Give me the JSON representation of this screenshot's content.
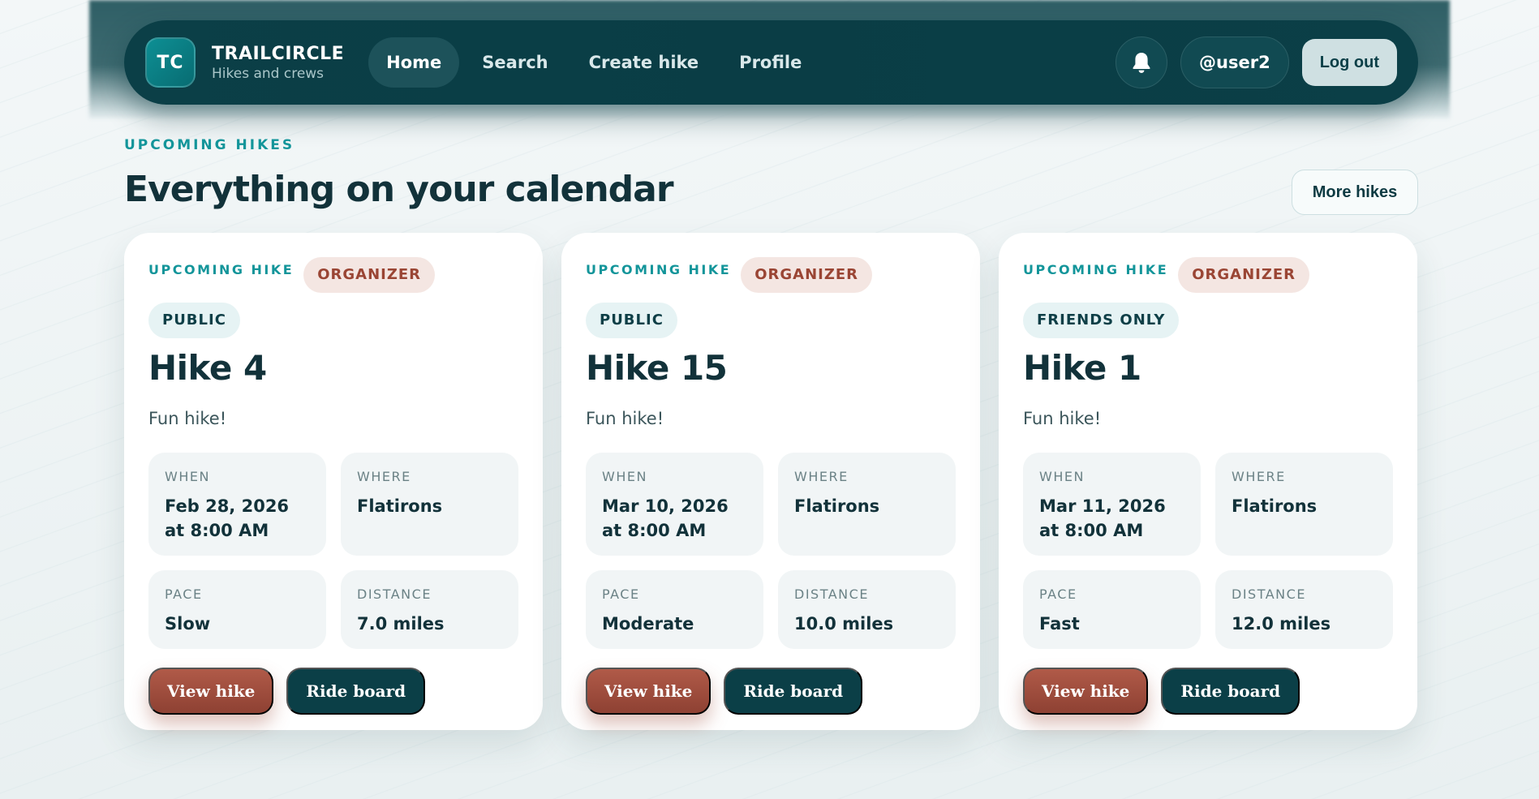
{
  "nav": {
    "logo_initials": "TC",
    "brand_name": "TRAILCIRCLE",
    "brand_subtitle": "Hikes and crews",
    "links": [
      {
        "label": "Home",
        "active": true
      },
      {
        "label": "Search",
        "active": false
      },
      {
        "label": "Create hike",
        "active": false
      },
      {
        "label": "Profile",
        "active": false
      }
    ],
    "bell_icon": "bell-icon",
    "user_handle": "@user2",
    "logout_label": "Log out"
  },
  "section": {
    "eyebrow": "UPCOMING HIKES",
    "title": "Everything on your calendar",
    "more_label": "More hikes"
  },
  "cards": [
    {
      "eyebrow": "UPCOMING HIKE",
      "role_badge": "ORGANIZER",
      "visibility_badge": "PUBLIC",
      "title": "Hike 4",
      "description": "Fun hike!",
      "when_label": "WHEN",
      "when_value": "Feb 28, 2026 at 8:00 AM",
      "where_label": "WHERE",
      "where_value": "Flatirons",
      "pace_label": "PACE",
      "pace_value": "Slow",
      "distance_label": "DISTANCE",
      "distance_value": "7.0 miles",
      "view_label": "View hike",
      "ride_label": "Ride board"
    },
    {
      "eyebrow": "UPCOMING HIKE",
      "role_badge": "ORGANIZER",
      "visibility_badge": "PUBLIC",
      "title": "Hike 15",
      "description": "Fun hike!",
      "when_label": "WHEN",
      "when_value": "Mar 10, 2026 at 8:00 AM",
      "where_label": "WHERE",
      "where_value": "Flatirons",
      "pace_label": "PACE",
      "pace_value": "Moderate",
      "distance_label": "DISTANCE",
      "distance_value": "10.0 miles",
      "view_label": "View hike",
      "ride_label": "Ride board"
    },
    {
      "eyebrow": "UPCOMING HIKE",
      "role_badge": "ORGANIZER",
      "visibility_badge": "FRIENDS ONLY",
      "title": "Hike 1",
      "description": "Fun hike!",
      "when_label": "WHEN",
      "when_value": "Mar 11, 2026 at 8:00 AM",
      "where_label": "WHERE",
      "where_value": "Flatirons",
      "pace_label": "PACE",
      "pace_value": "Fast",
      "distance_label": "DISTANCE",
      "distance_value": "12.0 miles",
      "view_label": "View hike",
      "ride_label": "Ride board"
    }
  ],
  "colors": {
    "nav_bg": "#0b3f47",
    "accent_teal": "#13959a",
    "organizer_text": "#9a4534",
    "view_button": "#a04f3f"
  }
}
